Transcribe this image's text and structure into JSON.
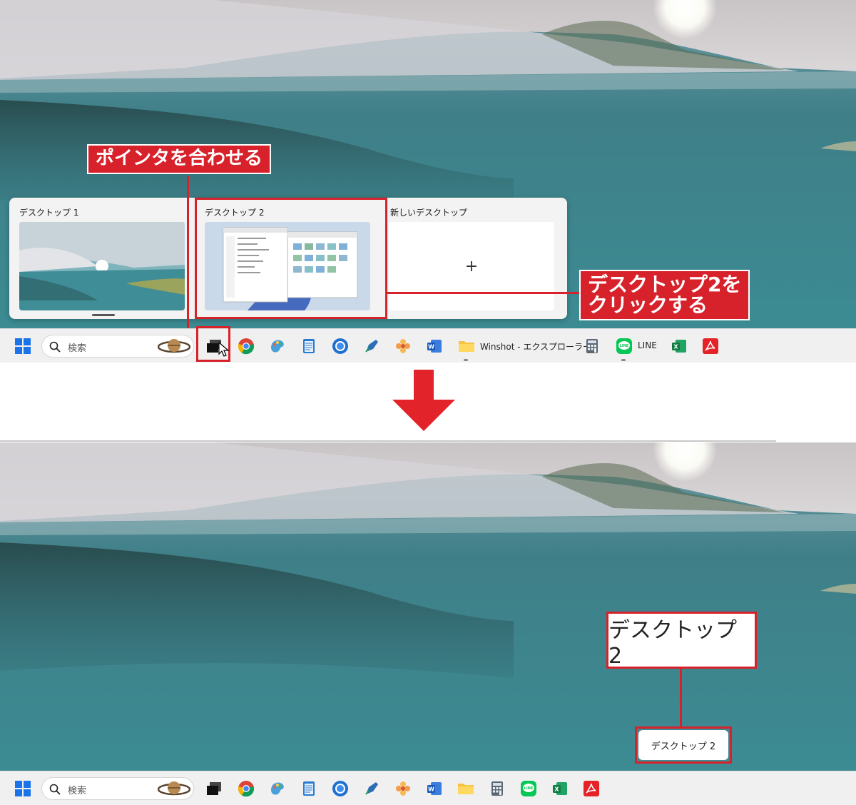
{
  "top": {
    "task_view": {
      "desktops": [
        {
          "title": "デスクトップ 1"
        },
        {
          "title": "デスクトップ 2"
        },
        {
          "title": "新しいデスクトップ",
          "plus": "+"
        }
      ]
    },
    "callout_pointer": "ポインタを合わせる",
    "callout_click": [
      "デスクトップ2を",
      "クリックする"
    ]
  },
  "taskbar": {
    "search_placeholder": "検索",
    "explorer_label": "Winshot - エクスプローラー",
    "line_label": "LINE",
    "icons": [
      "start-icon",
      "search-icon",
      "task-view-icon",
      "chrome-icon",
      "paint-icon",
      "notepad-icon",
      "thunderbird-icon",
      "pen-icon",
      "flower-app-icon",
      "word-icon",
      "folder-icon",
      "calculator-icon",
      "line-icon",
      "excel-icon",
      "acrobat-icon"
    ]
  },
  "bottom": {
    "desktop_name_large": "デスクトップ 2",
    "desktop_name_small": "デスクトップ 2"
  },
  "colors": {
    "annotation_red": "#d7222b",
    "taskbar": "#f0f0f0",
    "water": "#3d8a92"
  }
}
